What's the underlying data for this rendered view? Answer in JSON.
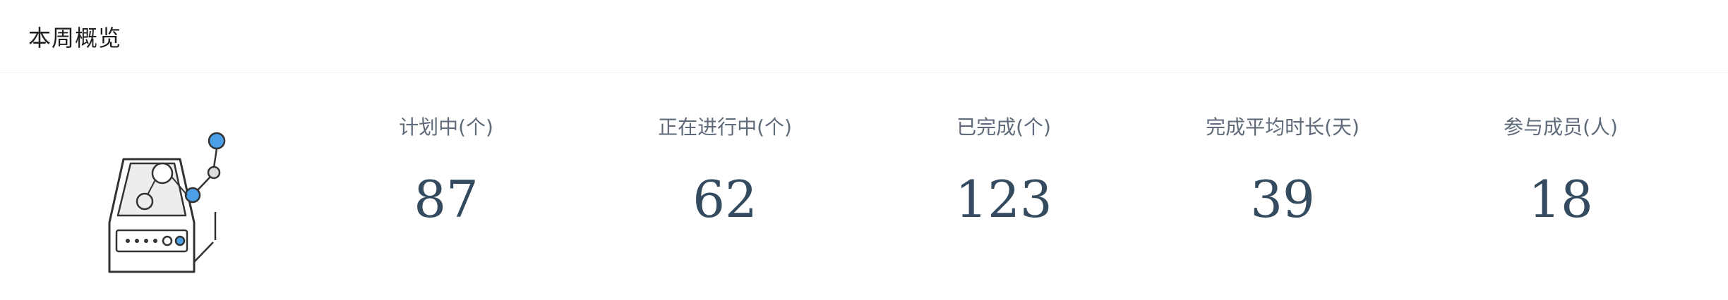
{
  "card": {
    "title": "本周概览"
  },
  "illustration": {
    "icon": "server-network-icon",
    "accent_color": "#4a9fe6"
  },
  "stats": [
    {
      "label": "计划中(个)",
      "value": "87"
    },
    {
      "label": "正在进行中(个)",
      "value": "62"
    },
    {
      "label": "已完成(个)",
      "value": "123"
    },
    {
      "label": "完成平均时长(天)",
      "value": "39"
    },
    {
      "label": "参与成员(人)",
      "value": "18"
    }
  ]
}
